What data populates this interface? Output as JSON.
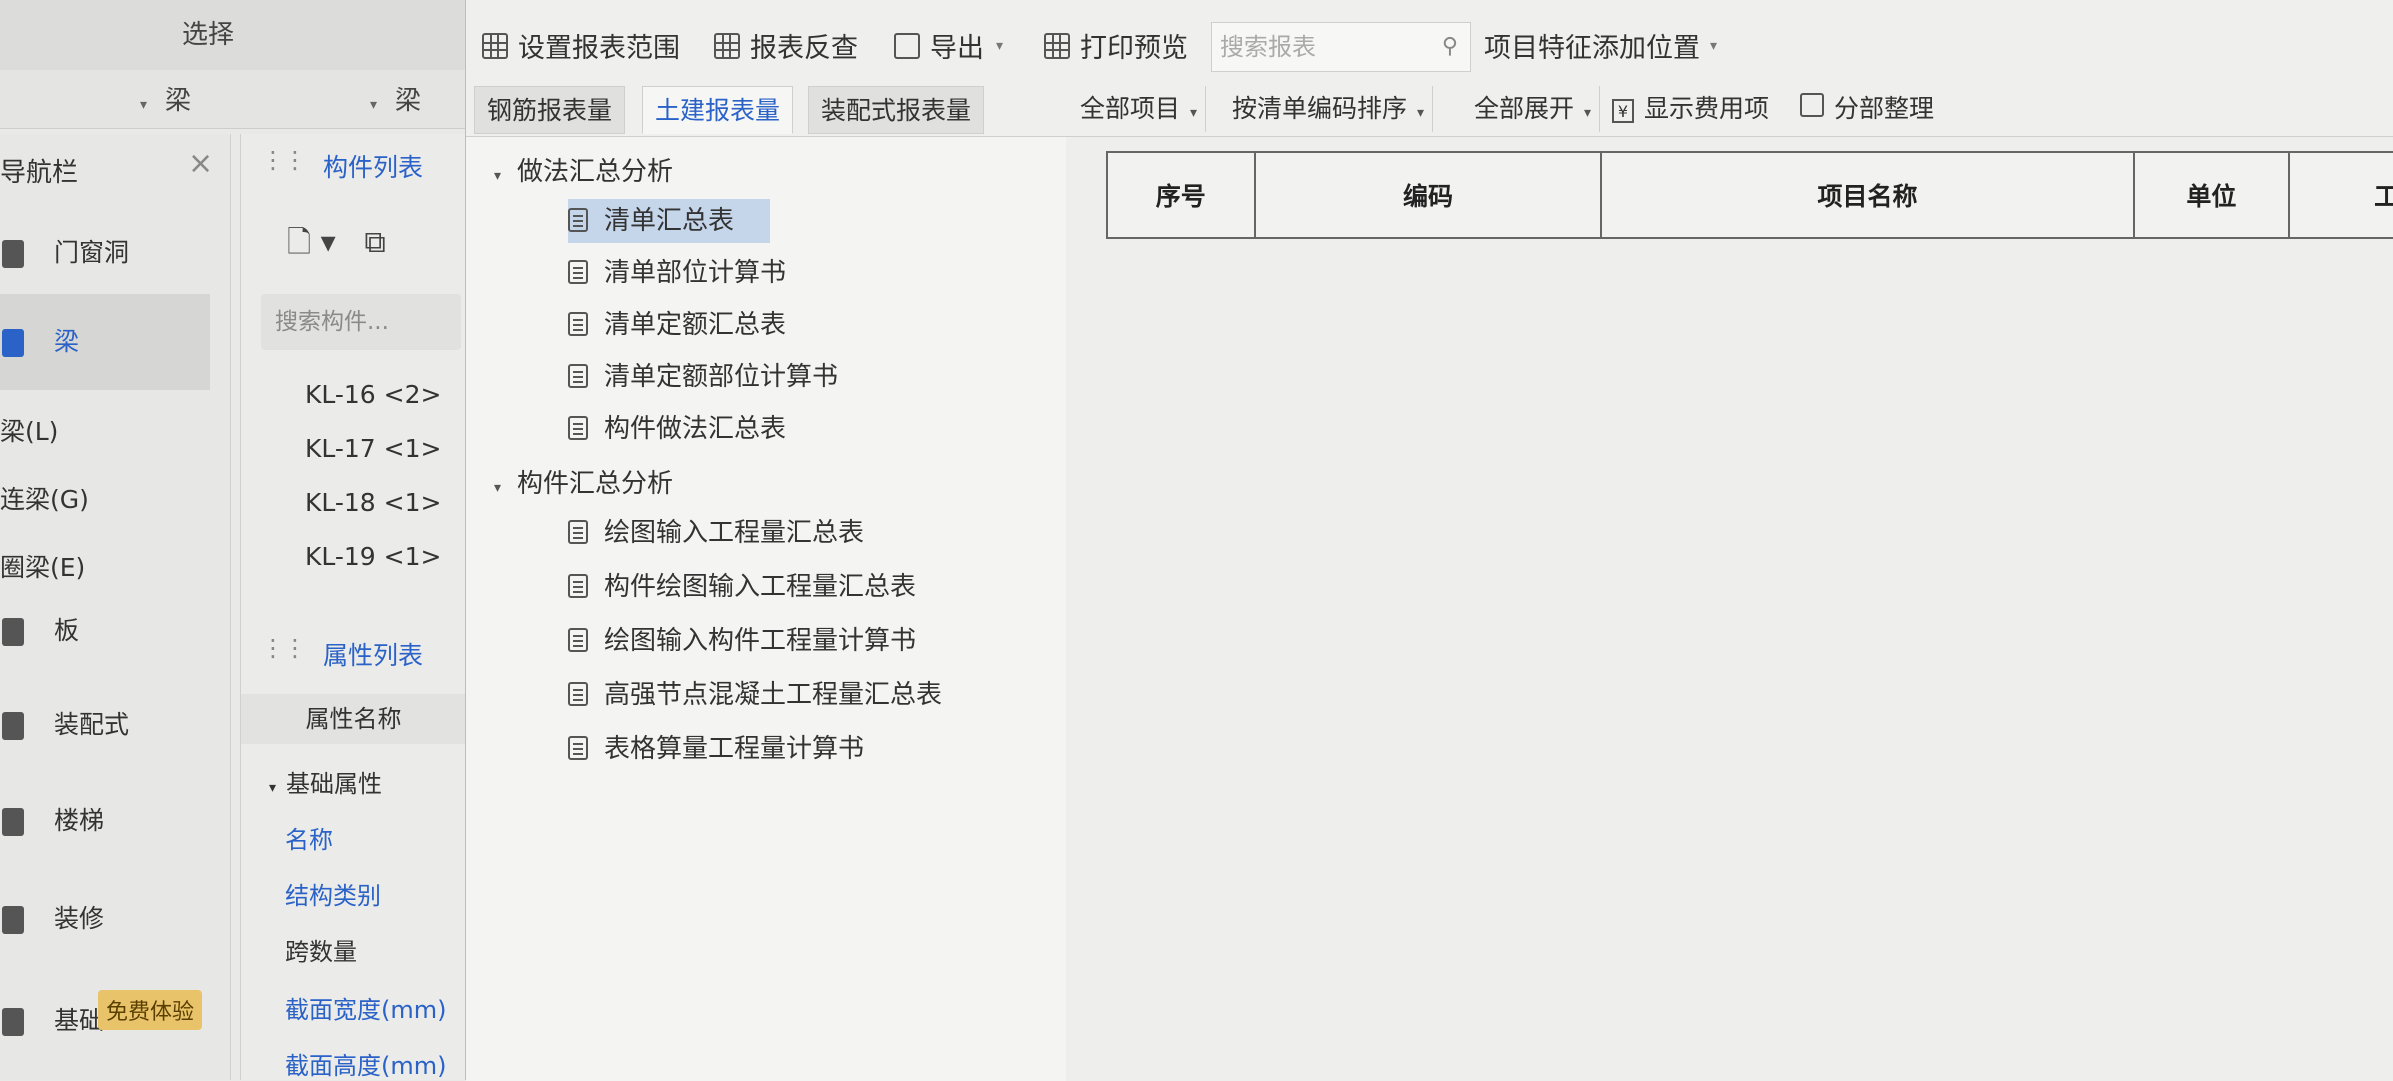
{
  "left": {
    "select_title": "选择",
    "filter1": "梁",
    "filter2": "梁",
    "nav": {
      "title": "导航栏",
      "close": "×",
      "items": [
        {
          "label": "门窗洞",
          "icon": "door-window-icon"
        },
        {
          "label": "梁",
          "icon": "beam-icon"
        },
        {
          "label": "板",
          "icon": "slab-icon"
        },
        {
          "label": "装配式",
          "icon": "prefab-icon"
        },
        {
          "label": "楼梯",
          "icon": "stair-icon"
        },
        {
          "label": "装修",
          "icon": "decoration-icon"
        },
        {
          "label": "基础",
          "icon": "foundation-icon"
        }
      ],
      "sub_items": [
        "梁(L)",
        "连梁(G)",
        "圈梁(E)"
      ],
      "trial_badge": "免费体验"
    },
    "components": {
      "tab_label": "构件列表",
      "search_placeholder": "搜索构件...",
      "items": [
        "KL-16 <2>",
        "KL-17 <1>",
        "KL-18 <1>",
        "KL-19 <1>"
      ]
    },
    "properties": {
      "tab_label": "属性列表",
      "column_header": "属性名称",
      "group": "基础属性",
      "rows": [
        {
          "label": "名称",
          "color": "#2a62c8"
        },
        {
          "label": "结构类别",
          "color": "#2a62c8"
        },
        {
          "label": "跨数量",
          "color": "#333333"
        },
        {
          "label": "截面宽度(mm)",
          "color": "#2a62c8"
        },
        {
          "label": "截面高度(mm)",
          "color": "#2a62c8"
        }
      ]
    }
  },
  "toolbar": {
    "set_range": "设置报表范围",
    "reverse_check": "报表反查",
    "export": "导出",
    "print_preview": "打印预览",
    "search_placeholder": "搜索报表",
    "feature_position": "项目特征添加位置"
  },
  "tabs": [
    "钢筋报表量",
    "土建报表量",
    "装配式报表量"
  ],
  "tree": {
    "groups": [
      {
        "label": "做法汇总分析",
        "items": [
          "清单汇总表",
          "清单部位计算书",
          "清单定额汇总表",
          "清单定额部位计算书",
          "构件做法汇总表"
        ]
      },
      {
        "label": "构件汇总分析",
        "items": [
          "绘图输入工程量汇总表",
          "构件绘图输入工程量汇总表",
          "绘图输入构件工程量计算书",
          "高强节点混凝土工程量汇总表",
          "表格算量工程量计算书"
        ]
      }
    ],
    "selected": "清单汇总表"
  },
  "right_toolbar": {
    "all_items": "全部项目",
    "sort_by_code": "按清单编码排序",
    "expand_all": "全部展开",
    "show_fee": "显示费用项",
    "section_tidy": "分部整理"
  },
  "table": {
    "columns": [
      "序号",
      "编码",
      "项目名称",
      "单位",
      "工程"
    ]
  },
  "colors": {
    "accent": "#2a62c8",
    "selected_row": "#c6d6ea"
  }
}
